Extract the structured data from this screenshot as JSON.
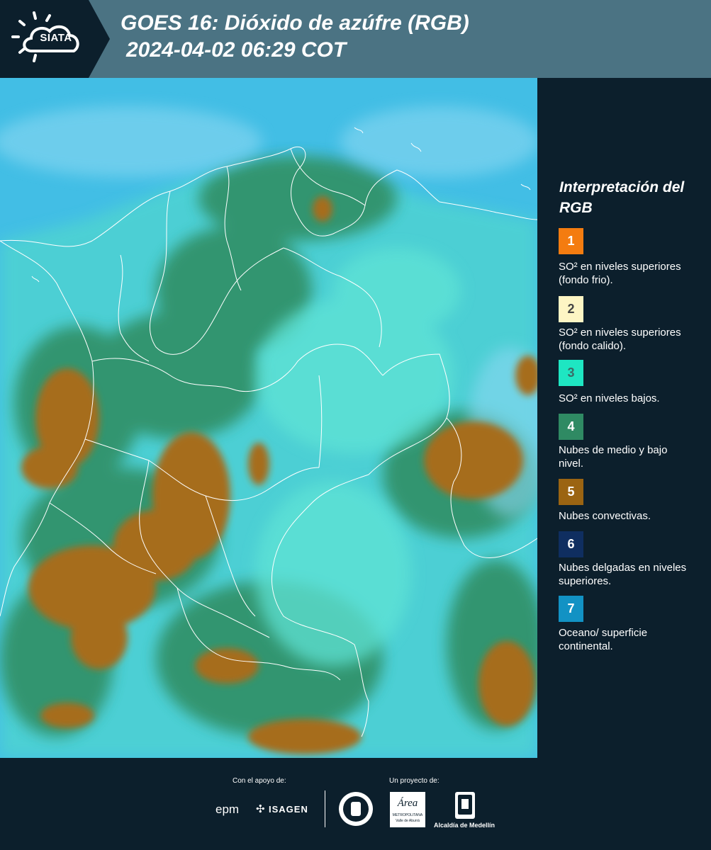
{
  "header": {
    "logo_text": "SIATA",
    "title": "GOES 16: Dióxido de azúfre (RGB)",
    "subtitle": "2024-04-02 06:29 COT",
    "bg_color": "#4b7383",
    "logo_bg_color": "#0c1f2c"
  },
  "legend": {
    "title": "Interpretación del RGB",
    "items": [
      {
        "num": "1",
        "color": "#f47c10",
        "num_color": "#ffffff",
        "desc": "SO² en niveles superiores (fondo frio)."
      },
      {
        "num": "2",
        "color": "#fdf5c4",
        "num_color": "#444444",
        "desc": "SO² en niveles superiores (fondo calido)."
      },
      {
        "num": "3",
        "color": "#1ee6c2",
        "num_color": "#3b6b66",
        "desc": "SO² en niveles bajos."
      },
      {
        "num": "4",
        "color": "#2f8a63",
        "num_color": "#ffffff",
        "desc": "Nubes de medio y bajo nivel."
      },
      {
        "num": "5",
        "color": "#9b6412",
        "num_color": "#ffffff",
        "desc": "Nubes convectivas."
      },
      {
        "num": "6",
        "color": "#0f2e60",
        "num_color": "#ffffff",
        "desc": "Nubes delgadas en niveles superiores."
      },
      {
        "num": "7",
        "color": "#1292c4",
        "num_color": "#ffffff",
        "desc": "Oceano/ superficie continental."
      }
    ]
  },
  "footer": {
    "support_label": "Con el apoyo de:",
    "project_label": "Un proyecto de:",
    "sponsors": [
      "epm",
      "ISAGEN"
    ],
    "partners": [
      "Área Metropolitana Valle de Aburrá",
      "Alcaldía de Medellín"
    ],
    "alcaldia_text": "Alcaldía de Medellín",
    "area_text": "Área",
    "area_sub": "METROPOLITANA",
    "area_sub2": "Valle de Aburrá"
  },
  "map": {
    "ocean_color": "#49c4e8",
    "land_color": "#4fd4d0",
    "cloud_green": "#2e8b5f",
    "convective_color": "#a66d1c",
    "border_color": "#ffffff"
  }
}
